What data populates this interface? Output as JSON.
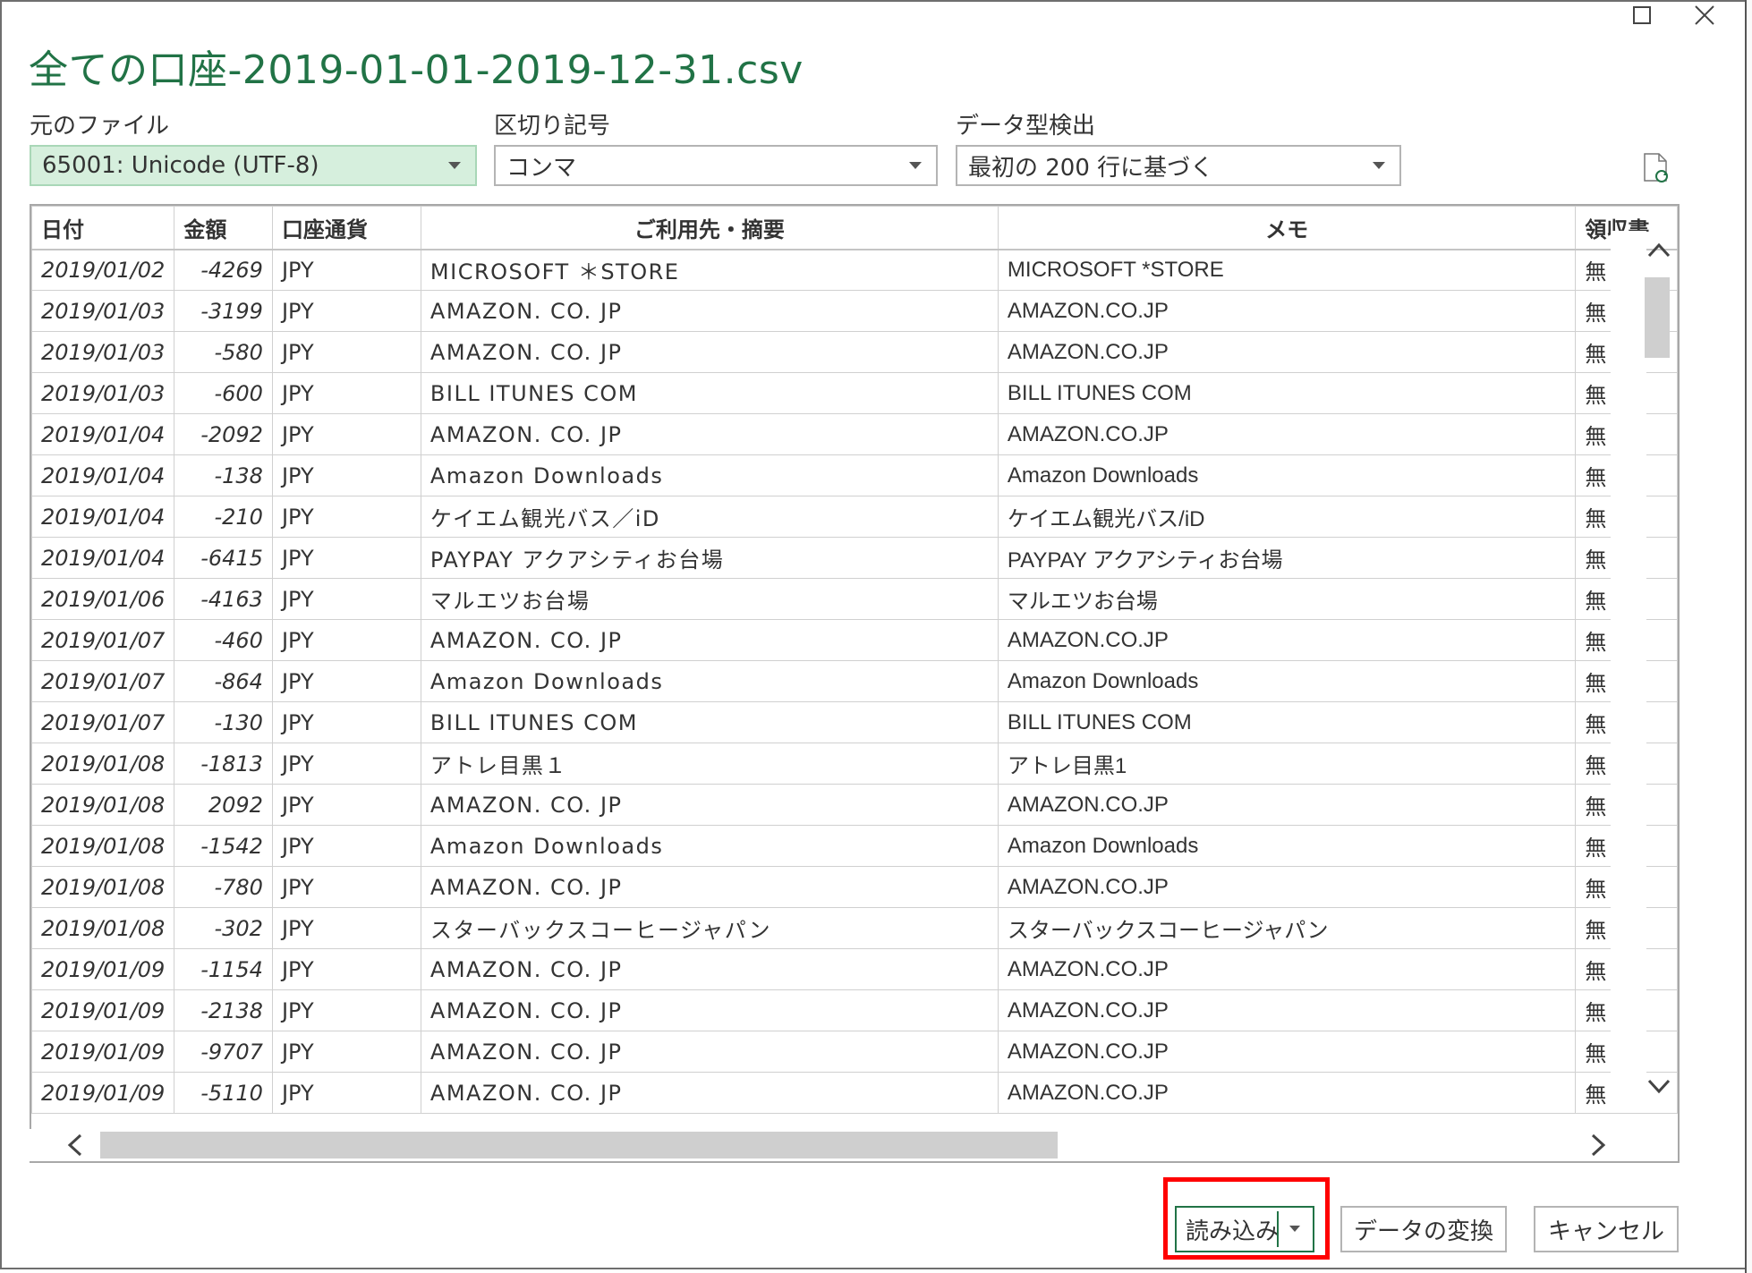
{
  "dialog": {
    "title_main": "全ての口座",
    "title_suffix": "-2019-01-01-2019-12-31.csv"
  },
  "options": {
    "file_origin": {
      "label": "元のファイル",
      "value": "65001: Unicode (UTF-8)"
    },
    "delimiter": {
      "label": "区切り記号",
      "value": "コンマ"
    },
    "type_detection": {
      "label": "データ型検出",
      "value": "最初の 200 行に基づく"
    }
  },
  "table": {
    "columns": [
      "日付",
      "金額",
      "口座通貨",
      "ご利用先・摘要",
      "メモ",
      "領収書"
    ],
    "rows": [
      [
        "2019/01/02",
        "-4269",
        "JPY",
        "MICROSOFT ＊STORE",
        "MICROSOFT *STORE",
        "無"
      ],
      [
        "2019/01/03",
        "-3199",
        "JPY",
        "AMAZON. CO. JP",
        "AMAZON.CO.JP",
        "無"
      ],
      [
        "2019/01/03",
        "-580",
        "JPY",
        "AMAZON. CO. JP",
        "AMAZON.CO.JP",
        "無"
      ],
      [
        "2019/01/03",
        "-600",
        "JPY",
        "BILL ITUNES COM",
        "BILL ITUNES COM",
        "無"
      ],
      [
        "2019/01/04",
        "-2092",
        "JPY",
        "AMAZON. CO. JP",
        "AMAZON.CO.JP",
        "無"
      ],
      [
        "2019/01/04",
        "-138",
        "JPY",
        "Amazon Downloads",
        "Amazon Downloads",
        "無"
      ],
      [
        "2019/01/04",
        "-210",
        "JPY",
        "ケイエム観光バス／iD",
        "ケイエム観光バス/iD",
        "無"
      ],
      [
        "2019/01/04",
        "-6415",
        "JPY",
        "PAYPAY アクアシティお台場",
        "PAYPAY アクアシティお台場",
        "無"
      ],
      [
        "2019/01/06",
        "-4163",
        "JPY",
        "マルエツお台場",
        "マルエツお台場",
        "無"
      ],
      [
        "2019/01/07",
        "-460",
        "JPY",
        "AMAZON. CO. JP",
        "AMAZON.CO.JP",
        "無"
      ],
      [
        "2019/01/07",
        "-864",
        "JPY",
        "Amazon Downloads",
        "Amazon Downloads",
        "無"
      ],
      [
        "2019/01/07",
        "-130",
        "JPY",
        "BILL ITUNES COM",
        "BILL ITUNES COM",
        "無"
      ],
      [
        "2019/01/08",
        "-1813",
        "JPY",
        "アトレ目黒１",
        "アトレ目黒1",
        "無"
      ],
      [
        "2019/01/08",
        "2092",
        "JPY",
        "AMAZON. CO. JP",
        "AMAZON.CO.JP",
        "無"
      ],
      [
        "2019/01/08",
        "-1542",
        "JPY",
        "Amazon Downloads",
        "Amazon Downloads",
        "無"
      ],
      [
        "2019/01/08",
        "-780",
        "JPY",
        "AMAZON. CO. JP",
        "AMAZON.CO.JP",
        "無"
      ],
      [
        "2019/01/08",
        "-302",
        "JPY",
        "スターバックスコーヒージャパン",
        "スターバックスコーヒージャパン",
        "無"
      ],
      [
        "2019/01/09",
        "-1154",
        "JPY",
        "AMAZON. CO. JP",
        "AMAZON.CO.JP",
        "無"
      ],
      [
        "2019/01/09",
        "-2138",
        "JPY",
        "AMAZON. CO. JP",
        "AMAZON.CO.JP",
        "無"
      ],
      [
        "2019/01/09",
        "-9707",
        "JPY",
        "AMAZON. CO. JP",
        "AMAZON.CO.JP",
        "無"
      ],
      [
        "2019/01/09",
        "-5110",
        "JPY",
        "AMAZON. CO. JP",
        "AMAZON.CO.JP",
        "無"
      ]
    ]
  },
  "buttons": {
    "load": "読み込み",
    "transform": "データの変換",
    "cancel": "キャンセル"
  },
  "icons": {
    "maximize": "maximize-icon",
    "close": "close-icon",
    "refresh": "refresh-file-icon"
  },
  "colors": {
    "title": "#217346",
    "highlight": "#ff0000",
    "selected_select_bg": "#d6efdd"
  }
}
